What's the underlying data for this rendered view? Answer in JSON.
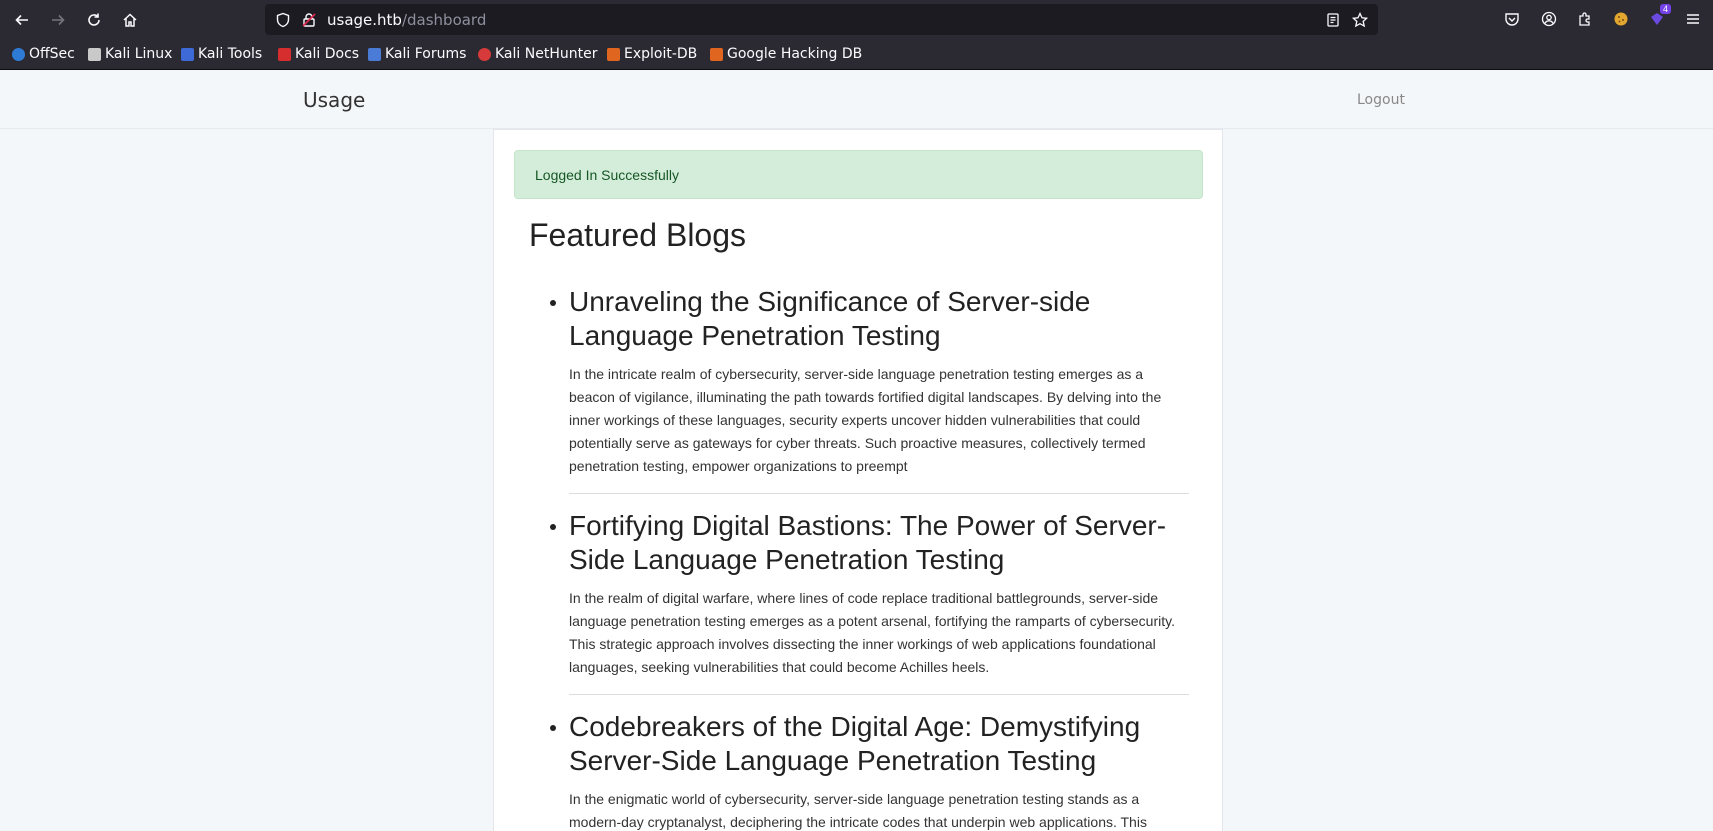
{
  "browser": {
    "url_host": "usage.htb",
    "url_path": "/dashboard",
    "extension_badge": "4",
    "bookmarks": [
      {
        "label": "OffSec",
        "color": "#2e7bd6"
      },
      {
        "label": "Kali Linux",
        "color": "#c9c9c9"
      },
      {
        "label": "Kali Tools",
        "color": "#3d6ad6"
      },
      {
        "label": "Kali Docs",
        "color": "#d62e2e"
      },
      {
        "label": "Kali Forums",
        "color": "#4a7bd6"
      },
      {
        "label": "Kali NetHunter",
        "color": "#d63a3a"
      },
      {
        "label": "Exploit-DB",
        "color": "#e0651f"
      },
      {
        "label": "Google Hacking DB",
        "color": "#e0651f"
      }
    ]
  },
  "site": {
    "brand": "Usage",
    "logout_label": "Logout"
  },
  "alert": {
    "message": "Logged In Successfully",
    "color": "#d4edda"
  },
  "blogs": {
    "heading": "Featured Blogs",
    "posts": [
      {
        "title": "Unraveling the Significance of Server-side Language Penetration Testing",
        "body": "In the intricate realm of cybersecurity, server-side language penetration testing emerges as a beacon of vigilance, illuminating the path towards fortified digital landscapes. By delving into the inner workings of these languages, security experts uncover hidden vulnerabilities that could potentially serve as gateways for cyber threats. Such proactive measures, collectively termed penetration testing, empower organizations to preempt"
      },
      {
        "title": "Fortifying Digital Bastions: The Power of Server-Side Language Penetration Testing",
        "body": "In the realm of digital warfare, where lines of code replace traditional battlegrounds, server-side language penetration testing emerges as a potent arsenal, fortifying the ramparts of cybersecurity. This strategic approach involves dissecting the inner workings of web applications foundational languages, seeking vulnerabilities that could become Achilles heels."
      },
      {
        "title": "Codebreakers of the Digital Age: Demystifying Server-Side Language Penetration Testing",
        "body": "In the enigmatic world of cybersecurity, server-side language penetration testing stands as a modern-day cryptanalyst, deciphering the intricate codes that underpin web applications. This"
      }
    ]
  }
}
